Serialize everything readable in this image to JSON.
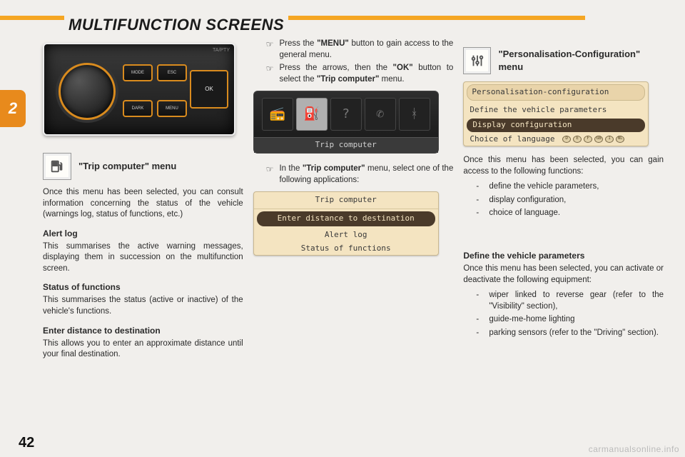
{
  "header": {
    "title": "MULTIFUNCTION SCREENS"
  },
  "side_tab": "2",
  "page_number": "42",
  "watermark": "carmanualsonline.info",
  "col1": {
    "panel": {
      "btn_mode": "MODE",
      "btn_dark": "DARK",
      "btn_esc": "ESC",
      "btn_menu": "MENU",
      "badge": "TA/PTY"
    },
    "trip_menu_title": "\"Trip computer\" menu",
    "trip_menu_intro": "Once this menu has been selected, you can consult information concerning the status of the vehicle (warnings log, status of functions, etc.)",
    "alert_log": {
      "title": "Alert log",
      "body": "This summarises the active warning messages, displaying them in succession on the multifunction screen."
    },
    "status": {
      "title": "Status of functions",
      "body": "This summarises the status (active or inactive) of the vehicle's functions."
    },
    "enter_dist": {
      "title": "Enter distance to destination",
      "body": "This allows you to enter an approximate distance until your final destination."
    }
  },
  "col2": {
    "step1_pre": "Press the ",
    "step1_bold": "\"MENU\"",
    "step1_post": " button to gain access to the general menu.",
    "step2_pre": "Press the arrows, then the ",
    "step2_bold1": "\"OK\"",
    "step2_mid": " button to select the ",
    "step2_bold2": "\"Trip computer\"",
    "step2_post": " menu.",
    "screen1_label": "Trip computer",
    "step3_pre": "In the ",
    "step3_bold": "\"Trip computer\"",
    "step3_post": " menu, select one of the following applications:",
    "screen2": {
      "title": "Trip computer",
      "selected": "Enter distance to destination",
      "row1": "Alert log",
      "row2": "Status of functions"
    }
  },
  "col3": {
    "title": "\"Personalisation-Configuration\" menu",
    "screen3": {
      "title": "Personalisation-configuration",
      "row1": "Define the vehicle parameters",
      "selected": "Display configuration",
      "row2_pre": "Choice of language"
    },
    "intro": "Once this menu has been selected, you can gain access to the following functions:",
    "func1": "define the vehicle parameters,",
    "func2": "display configuration,",
    "func3": "choice of language.",
    "define": {
      "title": "Define the vehicle parameters",
      "body": "Once this menu has been selected, you can activate or deactivate the following equipment:",
      "item1": "wiper linked to reverse gear (refer to the \"Visibility\" section),",
      "item2": "guide-me-home lighting",
      "item3": "parking sensors (refer to the \"Driving\" section)."
    }
  }
}
